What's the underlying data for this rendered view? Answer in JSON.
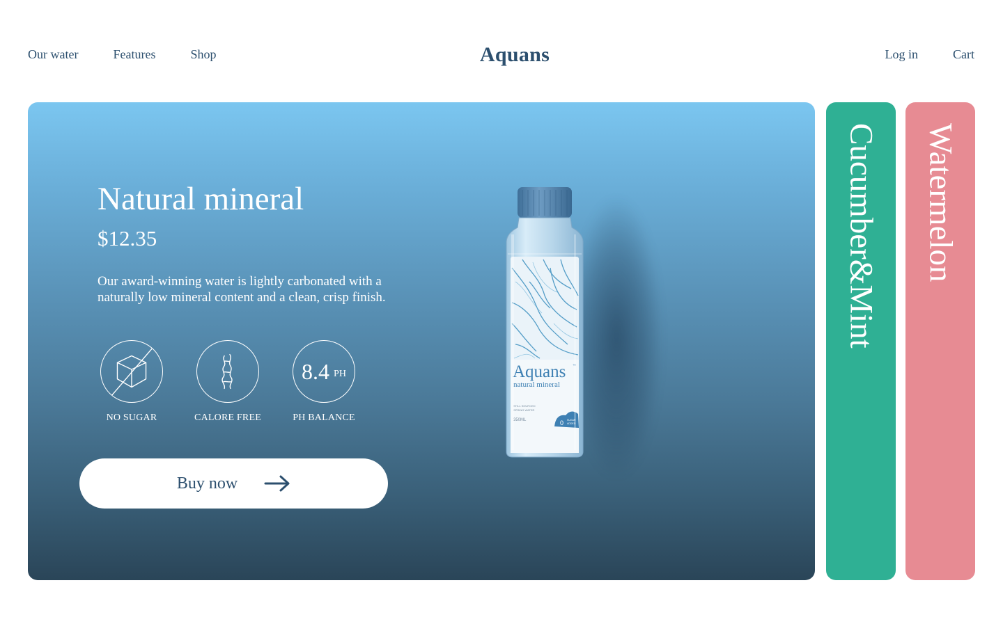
{
  "nav": {
    "left": [
      "Our water",
      "Features",
      "Shop"
    ],
    "brand": "Aquans",
    "right": [
      "Log in",
      "Cart"
    ]
  },
  "hero": {
    "title": "Natural mineral",
    "price": "$12.35",
    "description": "Our award-winning water is lightly carbonated with a naturally low mineral content and a clean, crisp finish.",
    "features": [
      {
        "icon": "no-sugar-cube-icon",
        "label": "NO SUGAR"
      },
      {
        "icon": "calorie-free-icon",
        "label": "CALORE FREE"
      },
      {
        "value": "8.4",
        "unit": "PH",
        "label": "PH BALANCE"
      }
    ],
    "buy_label": "Buy now",
    "bottle": {
      "brand": "Aquans",
      "tm": "™",
      "subtitle": "natural mineral",
      "fine_print": [
        "STILL SOURCED",
        "SPRING WATER"
      ],
      "volume": "350ML",
      "badge_symbol": "0",
      "badge_lines": [
        "SUGAR",
        "ADDED"
      ]
    }
  },
  "flavors": [
    {
      "label": "Cucumber&Mint",
      "color": "#2fb094"
    },
    {
      "label": "Watermelon",
      "color": "#e78b93"
    }
  ],
  "colors": {
    "text": "#2c4f6e",
    "hero_top": "#7bc6f0",
    "hero_bottom": "#2a4558"
  }
}
